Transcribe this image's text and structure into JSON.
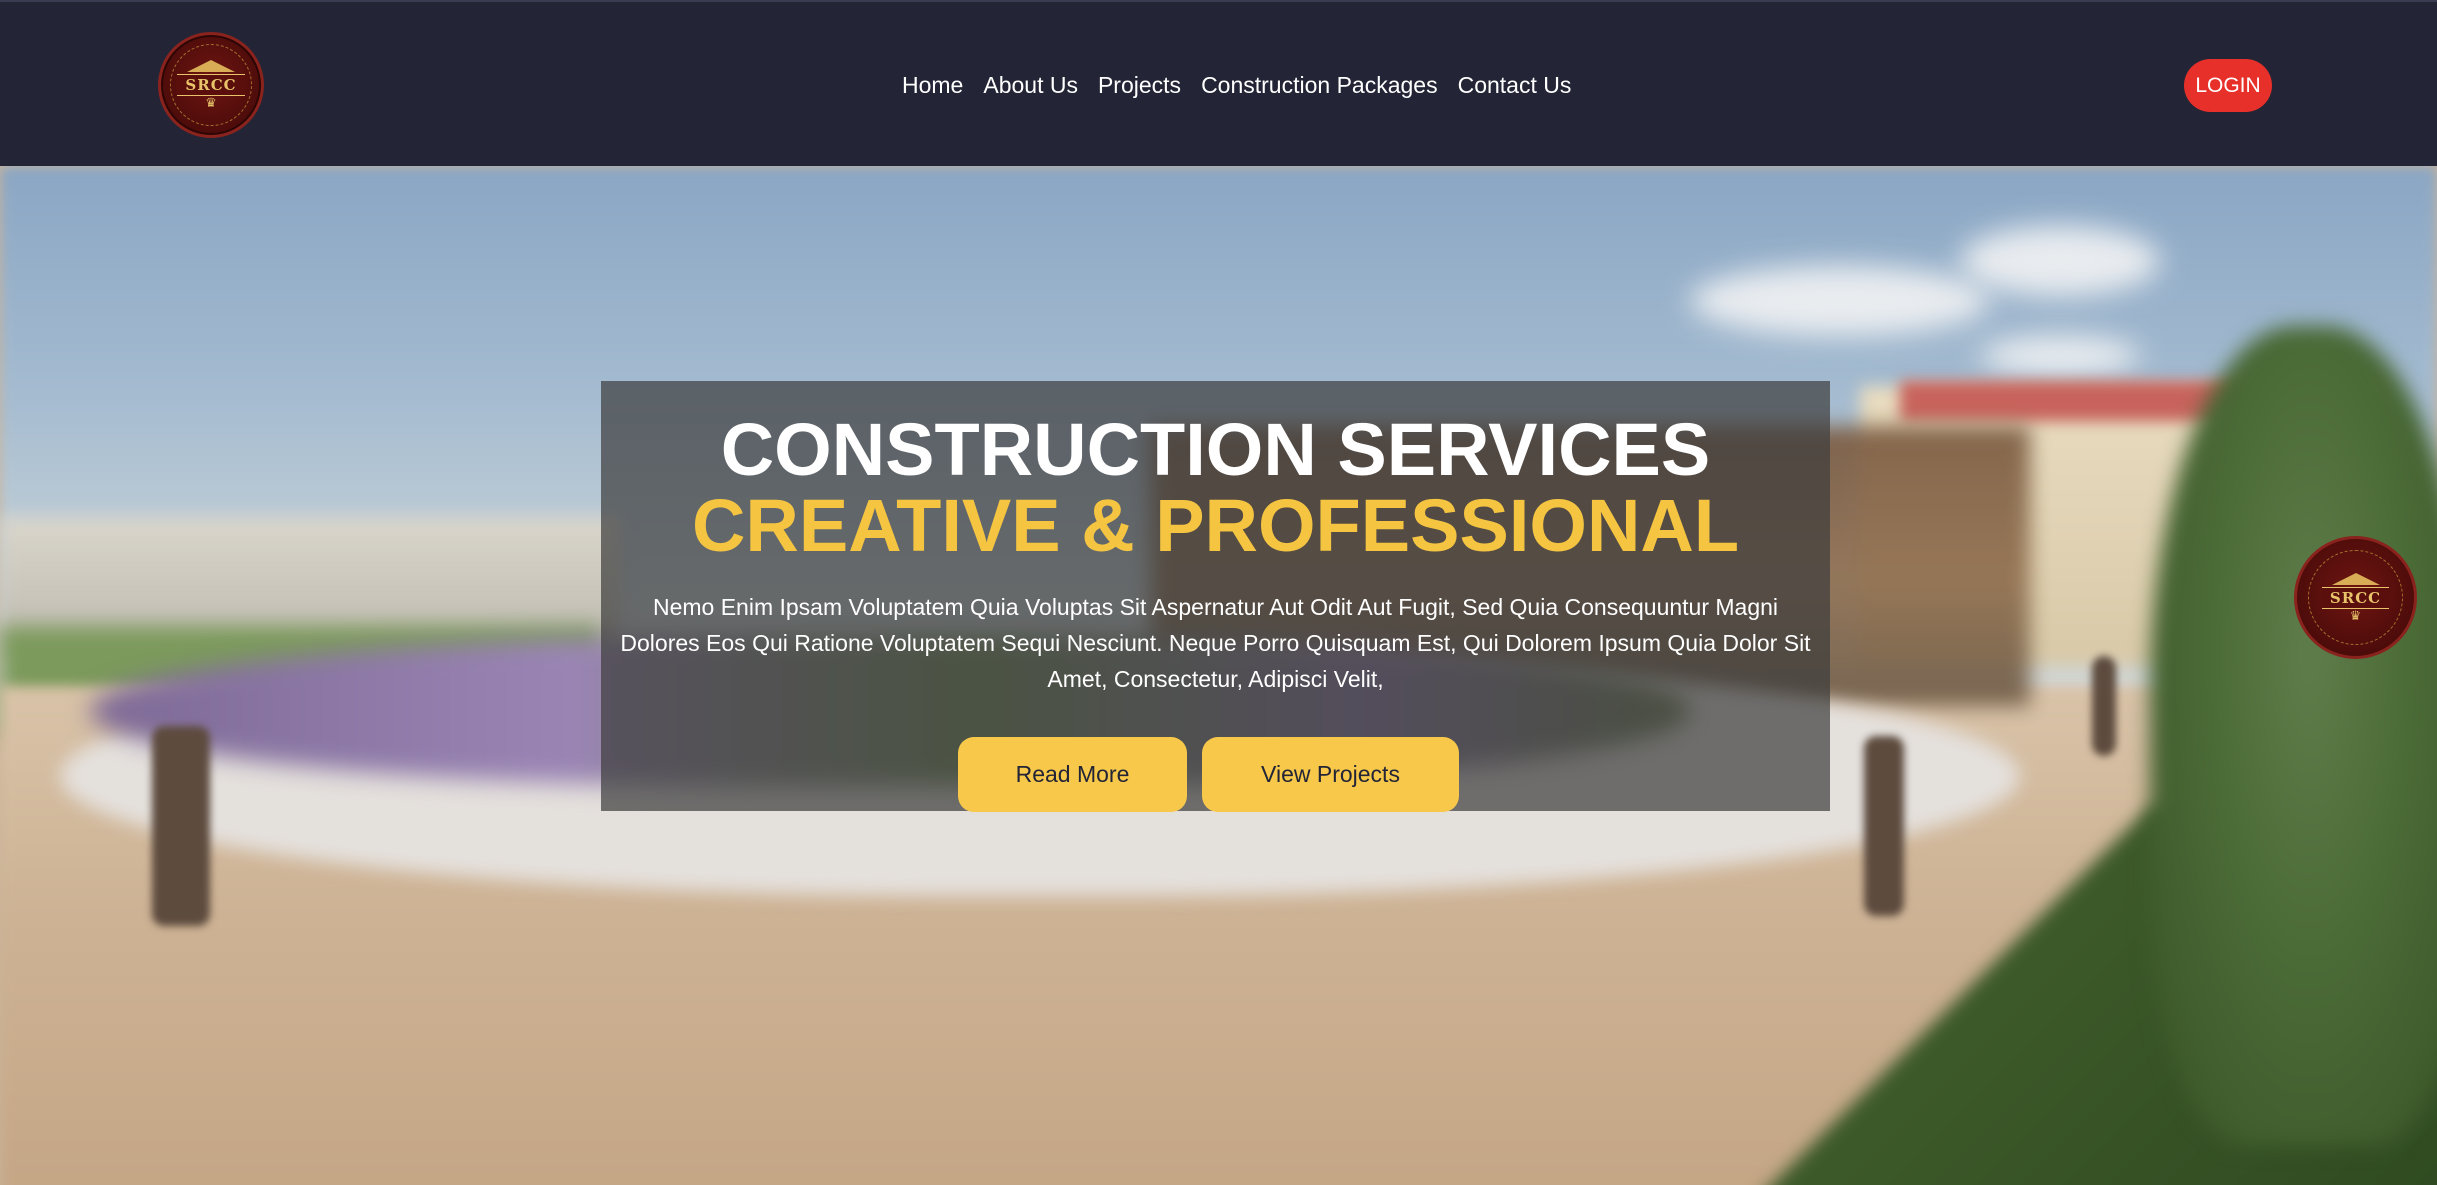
{
  "header": {
    "logo": {
      "text": "SRCC",
      "icon": "srcc-emblem-logo"
    },
    "nav": [
      {
        "label": "Home"
      },
      {
        "label": "About Us"
      },
      {
        "label": "Projects"
      },
      {
        "label": "Construction Packages"
      },
      {
        "label": "Contact Us"
      }
    ],
    "login_label": "LOGIN"
  },
  "hero": {
    "title": "CONSTRUCTION SERVICES",
    "subtitle": "CREATIVE & PROFESSIONAL",
    "description": "Nemo Enim Ipsam Voluptatem Quia Voluptas Sit Aspernatur Aut Odit Aut Fugit, Sed Quia Consequuntur Magni Dolores Eos Qui Ratione Voluptatem Sequi Nesciunt. Neque Porro Quisquam Est, Qui Dolorem Ipsum Quia Dolor Sit Amet, Consectetur, Adipisci Velit,",
    "buttons": {
      "read_more": "Read More",
      "view_projects": "View Projects"
    },
    "background": "blurred architectural rendering of plaza with pavilion and planters"
  },
  "floating_badge": {
    "text": "SRCC",
    "icon": "srcc-emblem-logo"
  },
  "colors": {
    "nav_bg": "#232536",
    "login_bg": "#e8302a",
    "accent_yellow": "#f5c542",
    "button_yellow": "#f7c84a",
    "logo_maroon": "#5a0f0c",
    "logo_gold": "#e8c36a"
  }
}
